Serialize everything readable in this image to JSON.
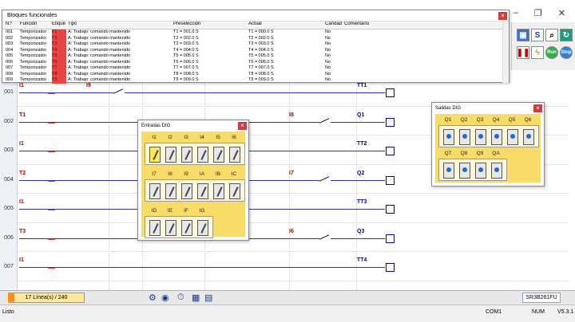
{
  "window": {
    "minimize": "–",
    "restore": "❐",
    "close": "✕"
  },
  "toolbar": {
    "s_label": "S",
    "run_label": "Run",
    "stop_label": "Stop"
  },
  "rows": [
    "001",
    "002",
    "003",
    "004",
    "005",
    "006",
    "007"
  ],
  "ladder": {
    "contacts_left": [
      "I1",
      "T1",
      "I1",
      "T2",
      "I1",
      "T3",
      "I1"
    ],
    "contacts_mid": [
      "I9",
      "",
      "",
      "",
      "",
      "",
      ""
    ],
    "contacts_right": [
      "",
      "I8",
      "",
      "I7",
      "",
      "I6",
      ""
    ],
    "coils": [
      "TT1",
      "Q1",
      "TT2",
      "Q2",
      "TT3",
      "Q3",
      "TT4"
    ]
  },
  "function_blocks": {
    "title": "Bloques funcionales",
    "headers": [
      "N.º",
      "Función",
      "Etique",
      "Tipo",
      "Preselección",
      "Actual",
      "Candad",
      "Comentario"
    ],
    "rows": [
      {
        "n": "001",
        "func": "Temporizador",
        "tag": "T1",
        "tipo": "A: Trabajo: comando mantenido",
        "pre": "T1 = 001.0 S",
        "act": "T1 = 000.0 S",
        "cand": "No"
      },
      {
        "n": "002",
        "func": "Temporizador",
        "tag": "T2",
        "tipo": "A: Trabajo: comando mantenido",
        "pre": "T2 = 002.0 S",
        "act": "T2 = 002.0 S",
        "cand": "No"
      },
      {
        "n": "003",
        "func": "Temporizador",
        "tag": "T3",
        "tipo": "A: Trabajo: comando mantenido",
        "pre": "T3 = 003.0 S",
        "act": "T3 = 003.0 S",
        "cand": "No"
      },
      {
        "n": "004",
        "func": "Temporizador",
        "tag": "T4",
        "tipo": "A: Trabajo: comando mantenido",
        "pre": "T4 = 004.0 S",
        "act": "T4 = 004.0 S",
        "cand": "No"
      },
      {
        "n": "005",
        "func": "Temporizador",
        "tag": "T5",
        "tipo": "A: Trabajo: comando mantenido",
        "pre": "T5 = 005.0 S",
        "act": "T5 = 005.0 S",
        "cand": "No"
      },
      {
        "n": "006",
        "func": "Temporizador",
        "tag": "T6",
        "tipo": "A: Trabajo: comando mantenido",
        "pre": "T6 = 006.0 S",
        "act": "T6 = 006.0 S",
        "cand": "No"
      },
      {
        "n": "007",
        "func": "Temporizador",
        "tag": "T7",
        "tipo": "A: Trabajo: comando mantenido",
        "pre": "T7 = 007.0 S",
        "act": "T7 = 007.0 S",
        "cand": "No"
      },
      {
        "n": "008",
        "func": "Temporizador",
        "tag": "T8",
        "tipo": "A: Trabajo: comando mantenido",
        "pre": "T8 = 008.0 S",
        "act": "T8 = 008.0 S",
        "cand": "No"
      },
      {
        "n": "009",
        "func": "Temporizador",
        "tag": "T9",
        "tipo": "A: Trabajo: comando mantenido",
        "pre": "T9 = 009.0 S",
        "act": "T9 = 009.0 S",
        "cand": "No"
      }
    ]
  },
  "inputs": {
    "title": "Entradas DIG",
    "row1": [
      "I1",
      "I2",
      "I3",
      "I4",
      "I5",
      "I6"
    ],
    "row2": [
      "I7",
      "I8",
      "I9",
      "IA",
      "IB",
      "IC"
    ],
    "row3": [
      "ID",
      "IE",
      "IF",
      "IG"
    ]
  },
  "outputs": {
    "title": "Salidas DIG",
    "row1": [
      "Q1",
      "Q2",
      "Q3",
      "Q4",
      "Q5",
      "Q6"
    ],
    "row2": [
      "Q7",
      "Q8",
      "Q9",
      "QA"
    ]
  },
  "status": {
    "lines": "17 Línea(s) / 240",
    "model": "SR3B261FU"
  },
  "bottom": {
    "state": "Listo",
    "port": "COM1",
    "num": "NUM",
    "version": "V5.3.1"
  },
  "colors": {
    "coil": "#0000a0",
    "wire": "#3030a0",
    "input_panel": "#f8dc6a",
    "tag_red": "#e84545"
  }
}
